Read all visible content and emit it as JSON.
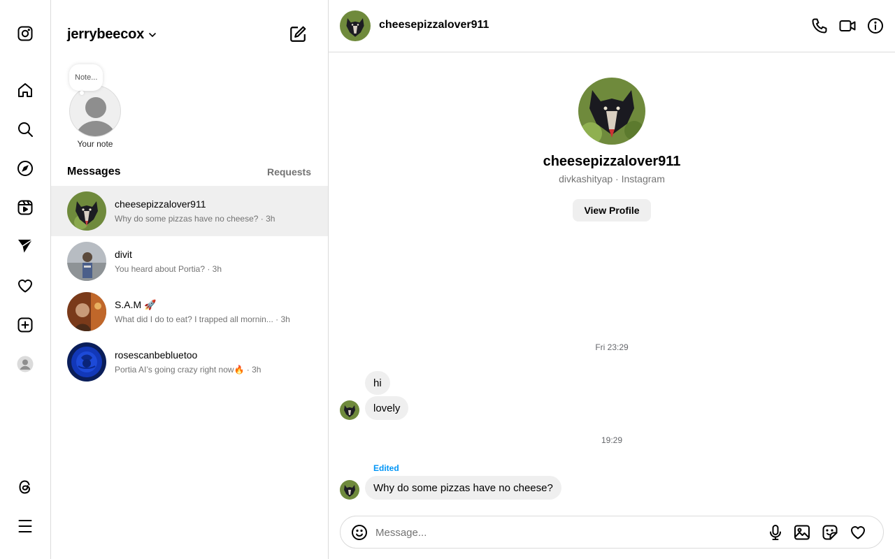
{
  "rail": {
    "items": [
      "instagram-logo",
      "home-icon",
      "search-icon",
      "explore-icon",
      "reels-icon",
      "messages-icon",
      "notifications-icon",
      "create-icon",
      "profile-icon",
      "threads-icon",
      "menu-icon"
    ]
  },
  "list": {
    "account_name": "jerrybeecox",
    "note_placeholder": "Note...",
    "note_label": "Your note",
    "messages_heading": "Messages",
    "requests_heading": "Requests",
    "threads": [
      {
        "name": "cheesepizzalover911",
        "preview": "Why do some pizzas have no cheese? · 3h",
        "active": true
      },
      {
        "name": "divit",
        "preview": "You heard about Portia? · 3h",
        "active": false
      },
      {
        "name": "S.A.M 🚀",
        "preview": "What did I do to eat? I trapped all mornin...  · 3h",
        "active": false
      },
      {
        "name": "rosescanbebluetoo",
        "preview": "Portia AI’s going crazy right now🔥 · 3h",
        "active": false
      }
    ]
  },
  "chat": {
    "header_name": "cheesepizzalover911",
    "profile_name": "cheesepizzalover911",
    "profile_sub": "divkashityap · Instagram",
    "view_profile": "View Profile",
    "timestamp_1": "Fri 23:29",
    "msg_1": "hi",
    "msg_2": "lovely",
    "timestamp_2": "19:29",
    "edited_label": "Edited",
    "msg_3": "Why do some pizzas have no cheese?",
    "composer_placeholder": "Message..."
  },
  "colors": {
    "border": "#dbdbdb",
    "active_row": "#efefef",
    "bubble": "#efefef",
    "muted_text": "#737373",
    "accent_blue": "#0095f6"
  }
}
